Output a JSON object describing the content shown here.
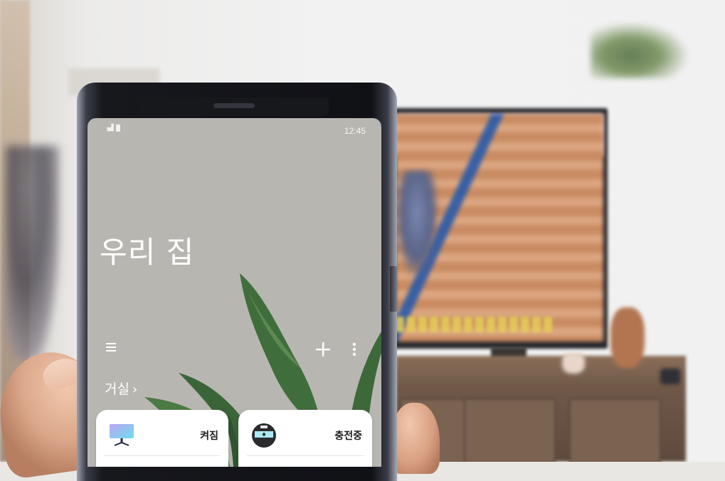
{
  "status_bar": {
    "signal_icon": "signal-icon",
    "battery_icon": "battery-icon",
    "time": "12:45"
  },
  "home": {
    "title": "우리 집",
    "room": "거실",
    "room_chevron": "›"
  },
  "toolbar": {
    "menu_icon": "hamburger-menu-icon",
    "add_icon": "plus-icon",
    "more_icon": "more-vertical-icon"
  },
  "devices": [
    {
      "icon": "tv-icon",
      "status": "켜짐"
    },
    {
      "icon": "robot-vacuum-icon",
      "status": "충전중"
    }
  ],
  "colors": {
    "screen_bg": "#b8b6b0",
    "card_bg": "#ffffff",
    "tv_icon": "#7fd6ef",
    "leaf": "#3d6a3a"
  }
}
